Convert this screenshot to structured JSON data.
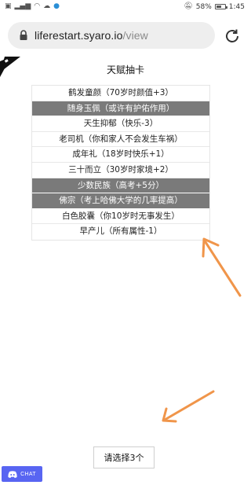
{
  "status_bar": {
    "battery": "58%",
    "time": "1:45"
  },
  "browser": {
    "url_host": "liferestart.syaro.io",
    "url_path": "/view"
  },
  "page": {
    "title": "天赋抽卡"
  },
  "talents": [
    {
      "label": "鹤发童颜（70岁时颜值+3）",
      "selected": false
    },
    {
      "label": "随身玉佩（或许有护佑作用）",
      "selected": true
    },
    {
      "label": "天生抑郁（快乐-3）",
      "selected": false
    },
    {
      "label": "老司机（你和家人不会发生车祸）",
      "selected": false
    },
    {
      "label": "成年礼（18岁时快乐+1）",
      "selected": false
    },
    {
      "label": "三十而立（30岁时家境+2）",
      "selected": false
    },
    {
      "label": "少数民族（高考+5分）",
      "selected": true
    },
    {
      "label": "佛宗（考上哈佛大学的几率提高）",
      "selected": true
    },
    {
      "label": "白色胶囊（你10岁时无事发生）",
      "selected": false
    },
    {
      "label": "早产儿（所有属性-1）",
      "selected": false
    }
  ],
  "confirm_button": {
    "label": "请选择3个"
  },
  "chat_widget": {
    "label": "CHAT",
    "color": "#5865f2"
  },
  "annotation_color": "#f0954a"
}
